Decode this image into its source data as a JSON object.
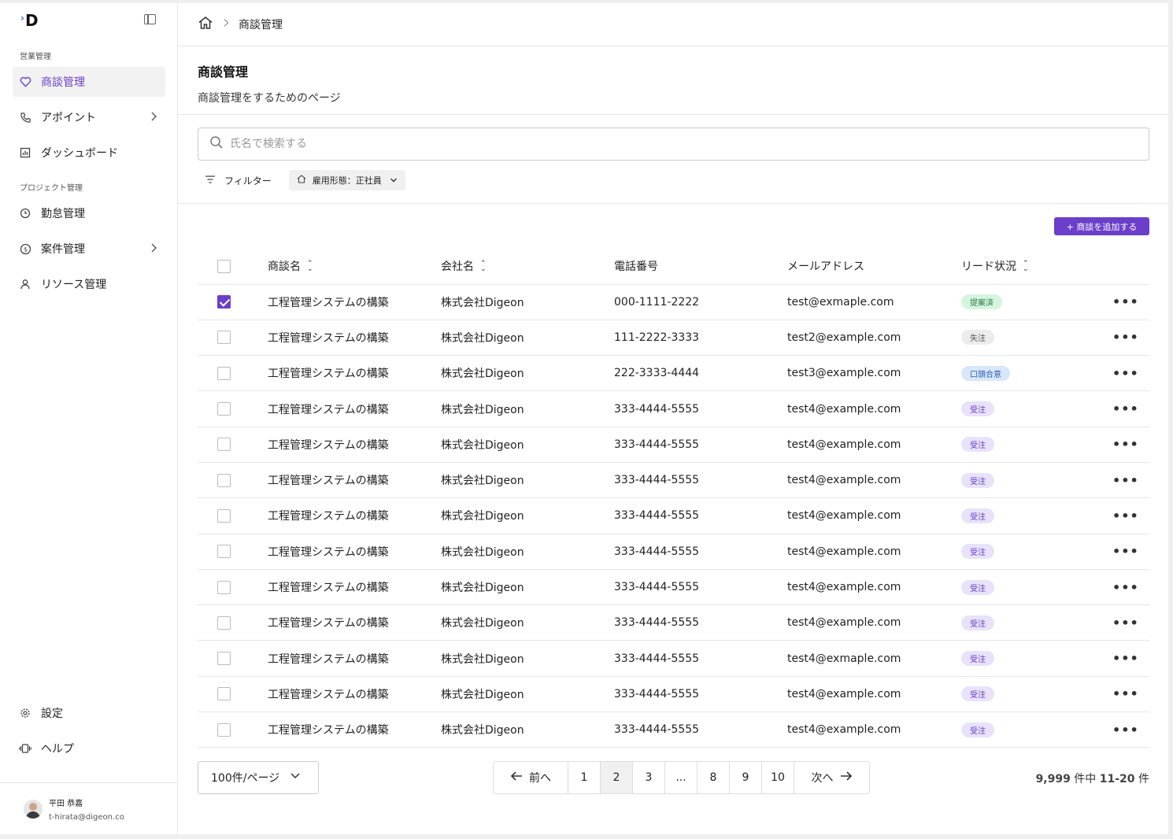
{
  "sidebar": {
    "logo": "D",
    "section1": "営業管理",
    "section2": "プロジェクト管理",
    "items": [
      {
        "label": "商談管理"
      },
      {
        "label": "アポイント"
      },
      {
        "label": "ダッシュボード"
      },
      {
        "label": "勤怠管理"
      },
      {
        "label": "案件管理"
      },
      {
        "label": "リソース管理"
      }
    ],
    "settings": "設定",
    "help": "ヘルプ",
    "user": {
      "name": "平田 恭嘉",
      "email": "t-hirata@digeon.co"
    }
  },
  "breadcrumb": {
    "current": "商談管理"
  },
  "page": {
    "title": "商談管理",
    "description": "商談管理をするためのページ"
  },
  "search": {
    "placeholder": "氏名で検索する"
  },
  "filter": {
    "label": "フィルター",
    "chip": "雇用形態：正社員"
  },
  "add_button": "+ 商談を追加する",
  "columns": {
    "name": "商談名",
    "company": "会社名",
    "phone": "電話番号",
    "email": "メールアドレス",
    "status": "リード状況"
  },
  "colors": {
    "accent": "#6b3fc9"
  },
  "rows": [
    {
      "checked": true,
      "name": "工程管理システムの構築",
      "company": "株式会社Digeon",
      "phone": "000-1111-2222",
      "email": "test@exmaple.com",
      "status": "提案済",
      "status_bg": "#d5f5df",
      "status_fg": "#2f7a48"
    },
    {
      "checked": false,
      "name": "工程管理システムの構築",
      "company": "株式会社Digeon",
      "phone": "111-2222-3333",
      "email": "test2@example.com",
      "status": "失注",
      "status_bg": "#ececec",
      "status_fg": "#555555"
    },
    {
      "checked": false,
      "name": "工程管理システムの構築",
      "company": "株式会社Digeon",
      "phone": "222-3333-4444",
      "email": "test3@example.com",
      "status": "口頭合意",
      "status_bg": "#d8e7fb",
      "status_fg": "#2a5fb0"
    },
    {
      "checked": false,
      "name": "工程管理システムの構築",
      "company": "株式会社Digeon",
      "phone": "333-4444-5555",
      "email": "test4@example.com",
      "status": "受注",
      "status_bg": "#e9e2fb",
      "status_fg": "#6b3fc9"
    },
    {
      "checked": false,
      "name": "工程管理システムの構築",
      "company": "株式会社Digeon",
      "phone": "333-4444-5555",
      "email": "test4@example.com",
      "status": "受注",
      "status_bg": "#e9e2fb",
      "status_fg": "#6b3fc9"
    },
    {
      "checked": false,
      "name": "工程管理システムの構築",
      "company": "株式会社Digeon",
      "phone": "333-4444-5555",
      "email": "test4@example.com",
      "status": "受注",
      "status_bg": "#e9e2fb",
      "status_fg": "#6b3fc9"
    },
    {
      "checked": false,
      "name": "工程管理システムの構築",
      "company": "株式会社Digeon",
      "phone": "333-4444-5555",
      "email": "test4@example.com",
      "status": "受注",
      "status_bg": "#e9e2fb",
      "status_fg": "#6b3fc9"
    },
    {
      "checked": false,
      "name": "工程管理システムの構築",
      "company": "株式会社Digeon",
      "phone": "333-4444-5555",
      "email": "test4@example.com",
      "status": "受注",
      "status_bg": "#e9e2fb",
      "status_fg": "#6b3fc9"
    },
    {
      "checked": false,
      "name": "工程管理システムの構築",
      "company": "株式会社Digeon",
      "phone": "333-4444-5555",
      "email": "test4@example.com",
      "status": "受注",
      "status_bg": "#e9e2fb",
      "status_fg": "#6b3fc9"
    },
    {
      "checked": false,
      "name": "工程管理システムの構築",
      "company": "株式会社Digeon",
      "phone": "333-4444-5555",
      "email": "test4@example.com",
      "status": "受注",
      "status_bg": "#e9e2fb",
      "status_fg": "#6b3fc9"
    },
    {
      "checked": false,
      "name": "工程管理システムの構築",
      "company": "株式会社Digeon",
      "phone": "333-4444-5555",
      "email": "test4@exmaple.com",
      "status": "受注",
      "status_bg": "#e9e2fb",
      "status_fg": "#6b3fc9"
    },
    {
      "checked": false,
      "name": "工程管理システムの構築",
      "company": "株式会社Digeon",
      "phone": "333-4444-5555",
      "email": "test4@example.com",
      "status": "受注",
      "status_bg": "#e9e2fb",
      "status_fg": "#6b3fc9"
    },
    {
      "checked": false,
      "name": "工程管理システムの構築",
      "company": "株式会社Digeon",
      "phone": "333-4444-5555",
      "email": "test4@example.com",
      "status": "受注",
      "status_bg": "#e9e2fb",
      "status_fg": "#6b3fc9"
    }
  ],
  "pagination": {
    "per_page": "100件/ページ",
    "prev": "前へ",
    "next": "次へ",
    "pages": [
      "1",
      "2",
      "3",
      "...",
      "8",
      "9",
      "10"
    ],
    "current": "2",
    "total": "9,999",
    "total_suffix": " 件中 ",
    "range": "11-20",
    "range_suffix": " 件"
  }
}
